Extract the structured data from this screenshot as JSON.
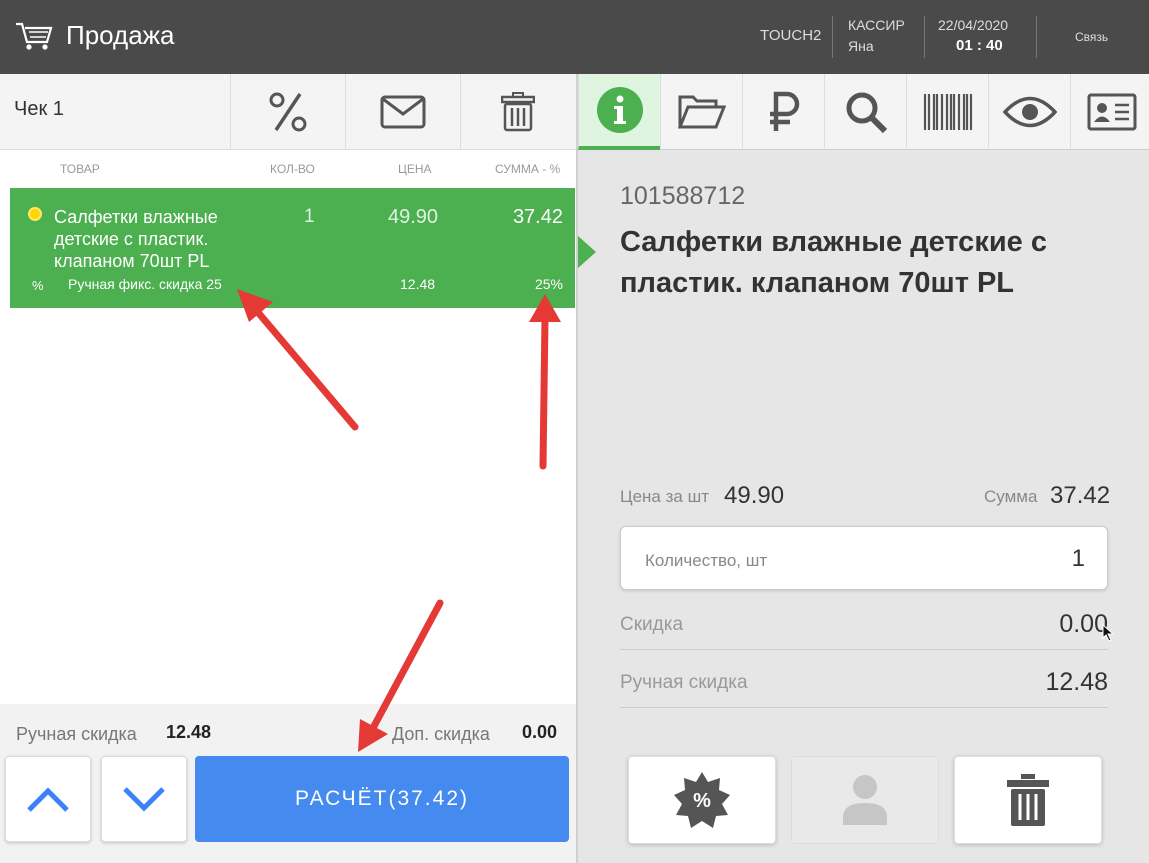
{
  "topbar": {
    "title": "Продажа",
    "terminal": "TOUCH2",
    "cashier_label": "КАССИР",
    "cashier_name": "Яна",
    "date": "22/04/2020",
    "time": "01 : 40",
    "link": "Связь"
  },
  "receipt": {
    "name": "Чек 1",
    "toolbar_icons": [
      "percent-icon",
      "envelope-icon",
      "trash-icon"
    ],
    "columns": {
      "item": "ТОВАР",
      "qty": "КОЛ-ВО",
      "price": "ЦЕНА",
      "sum": "СУММА - %"
    },
    "rows": [
      {
        "name": "Салфетки влажные детские с пластик. клапаном 70шт PL",
        "qty": "1",
        "price": "49.90",
        "sum": "37.42",
        "discount_sign": "%",
        "discount_name": "Ручная фикс. скидка 25",
        "discount_value": "12.48",
        "discount_pct": "25%"
      }
    ],
    "footer": {
      "manual_discount_label": "Ручная скидка",
      "manual_discount_value": "12.48",
      "extra_discount_label": "Доп. скидка",
      "extra_discount_value": "0.00",
      "pay_label": "РАСЧЁТ(37.42)"
    }
  },
  "details": {
    "tabs": [
      "info-icon",
      "folder-open-icon",
      "ruble-icon",
      "search-icon",
      "barcode-icon",
      "eye-icon",
      "id-card-icon"
    ],
    "code": "101588712",
    "name": "Салфетки влажные детские с пластик. клапаном 70шт PL",
    "unit_price_label": "Цена за шт",
    "unit_price": "49.90",
    "sum_label": "Сумма",
    "sum": "37.42",
    "qty_label": "Количество, шт",
    "qty": "1",
    "discount_label": "Скидка",
    "discount": "0.00",
    "manual_discount_label": "Ручная скидка",
    "manual_discount": "12.48",
    "action_icons": [
      "discount-badge-icon",
      "person-icon",
      "trash-icon"
    ]
  },
  "colors": {
    "topbar": "#4a4a4a",
    "selected_row": "#4caf50",
    "pay_button": "#448aef",
    "arrow": "#e53935"
  }
}
